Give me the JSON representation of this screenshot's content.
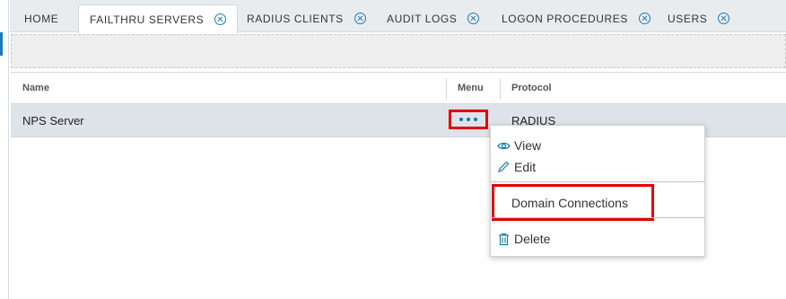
{
  "tabs": [
    {
      "label": "HOME",
      "closable": false,
      "active": false
    },
    {
      "label": "FAILTHRU SERVERS",
      "closable": true,
      "active": true
    },
    {
      "label": "RADIUS CLIENTS",
      "closable": true,
      "active": false
    },
    {
      "label": "AUDIT LOGS",
      "closable": true,
      "active": false
    },
    {
      "label": "LOGON PROCEDURES",
      "closable": true,
      "active": false
    },
    {
      "label": "USERS",
      "closable": true,
      "active": false
    }
  ],
  "grid": {
    "columns": [
      "Name",
      "Menu",
      "Protocol"
    ],
    "rows": [
      {
        "name": "NPS Server",
        "menu": "•••",
        "protocol": "RADIUS"
      }
    ]
  },
  "context_menu": {
    "items": [
      {
        "label": "View",
        "icon": "eye-icon"
      },
      {
        "label": "Edit",
        "icon": "pencil-icon"
      },
      {
        "label": "Domain Connections",
        "icon": ""
      },
      {
        "label": "Delete",
        "icon": "trash-icon"
      }
    ]
  },
  "colors": {
    "accent": "#1f7ab5",
    "highlight_annotation": "#e30000",
    "selected_row": "#dde3e9"
  }
}
